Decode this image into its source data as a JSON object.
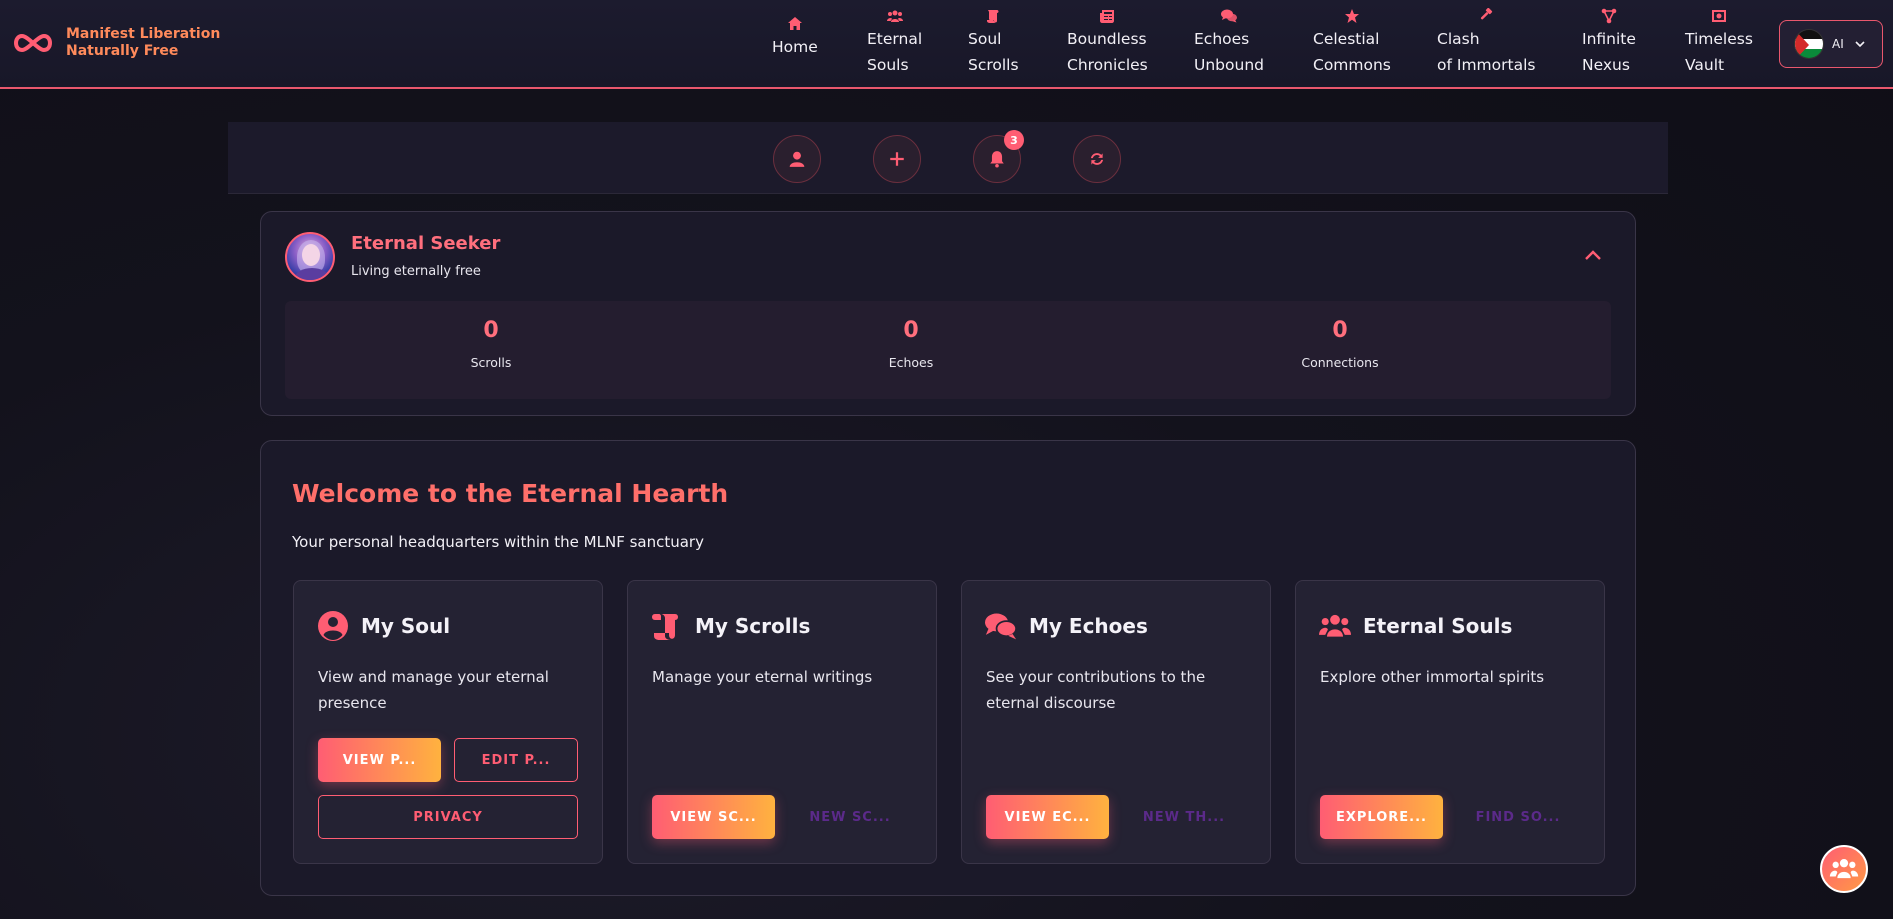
{
  "header": {
    "logo_line1": "Manifest Liberation",
    "logo_line2": "Naturally Free",
    "nav": [
      {
        "label": "Home",
        "icon": "home-icon"
      },
      {
        "label": "Eternal\nSouls",
        "icon": "users-icon"
      },
      {
        "label": "Soul\nScrolls",
        "icon": "scroll-icon"
      },
      {
        "label": "Boundless\nChronicles",
        "icon": "newspaper-icon"
      },
      {
        "label": "Echoes\nUnbound",
        "icon": "comments-icon"
      },
      {
        "label": "Celestial\nCommons",
        "icon": "star-icon"
      },
      {
        "label": "Clash\nof Immortals",
        "icon": "gavel-icon"
      },
      {
        "label": "Infinite\nNexus",
        "icon": "network-icon"
      },
      {
        "label": "Timeless\nVault",
        "icon": "vault-icon"
      }
    ],
    "language_code": "AI"
  },
  "toolbar": {
    "buttons": [
      {
        "name": "profile-icon"
      },
      {
        "name": "plus-icon"
      },
      {
        "name": "bell-icon",
        "badge": "3"
      },
      {
        "name": "refresh-icon"
      }
    ]
  },
  "profile": {
    "name": "Eternal Seeker",
    "subtitle": "Living eternally free",
    "stats": [
      {
        "value": "0",
        "label": "Scrolls"
      },
      {
        "value": "0",
        "label": "Echoes"
      },
      {
        "value": "0",
        "label": "Connections"
      }
    ]
  },
  "welcome": {
    "title": "Welcome to the Eternal Hearth",
    "subtitle": "Your personal headquarters within the MLNF sanctuary",
    "cards": [
      {
        "title": "My Soul",
        "icon": "user-circle-icon",
        "description": "View and manage your eternal presence",
        "primary": "VIEW P...",
        "secondary": "EDIT P...",
        "tertiary": "PRIVACY"
      },
      {
        "title": "My Scrolls",
        "icon": "scroll-icon",
        "description": "Manage your eternal writings",
        "primary": "VIEW SC...",
        "secondary": "NEW SC..."
      },
      {
        "title": "My Echoes",
        "icon": "comments-icon",
        "description": "See your contributions to the eternal discourse",
        "primary": "VIEW EC...",
        "secondary": "NEW TH..."
      },
      {
        "title": "Eternal Souls",
        "icon": "users-icon",
        "description": "Explore other immortal spirits",
        "primary": "EXPLORE...",
        "secondary": "FIND SO..."
      }
    ]
  },
  "colors": {
    "accent": "#ff5d73",
    "accent_orange": "#ffb23f",
    "card_bg": "#1b1929",
    "header_bg": "#1c1b2e"
  }
}
